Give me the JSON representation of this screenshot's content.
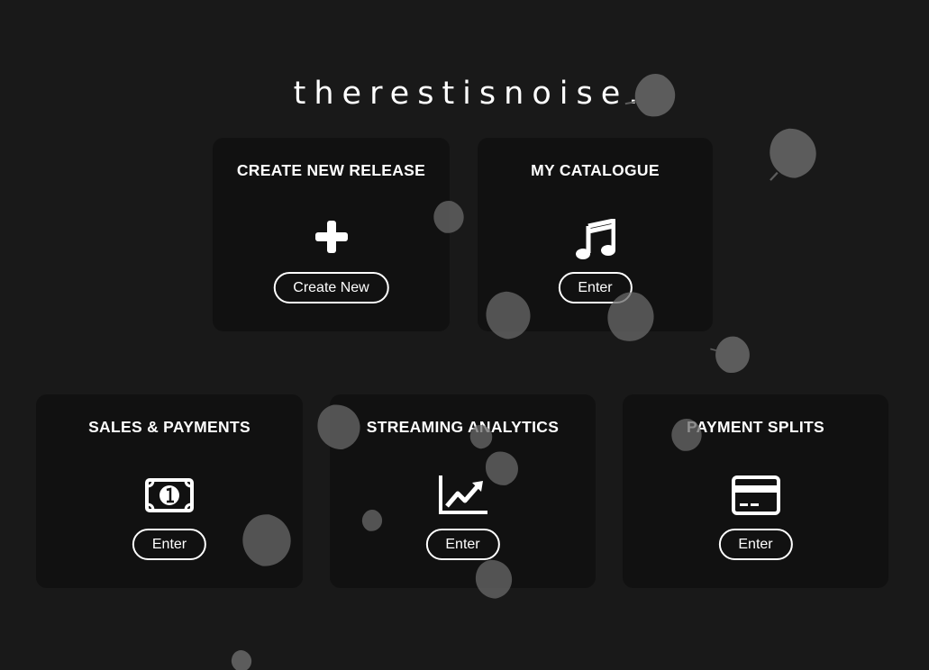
{
  "brand": {
    "title": "therestisnoise."
  },
  "cards": {
    "create": {
      "title": "CREATE NEW RELEASE",
      "icon": "plus-icon",
      "button": "Create New"
    },
    "catalogue": {
      "title": "MY CATALOGUE",
      "icon": "music-note-icon",
      "button": "Enter"
    },
    "sales": {
      "title": "SALES & PAYMENTS",
      "icon": "banknote-icon",
      "button": "Enter"
    },
    "streaming": {
      "title": "STREAMING ANALYTICS",
      "icon": "line-chart-icon",
      "button": "Enter"
    },
    "splits": {
      "title": "PAYMENT SPLITS",
      "icon": "credit-card-icon",
      "button": "Enter"
    }
  },
  "theme": {
    "background": "#191919",
    "card": "#111111",
    "text": "#ffffff",
    "leaf": "#5a5a5a"
  }
}
